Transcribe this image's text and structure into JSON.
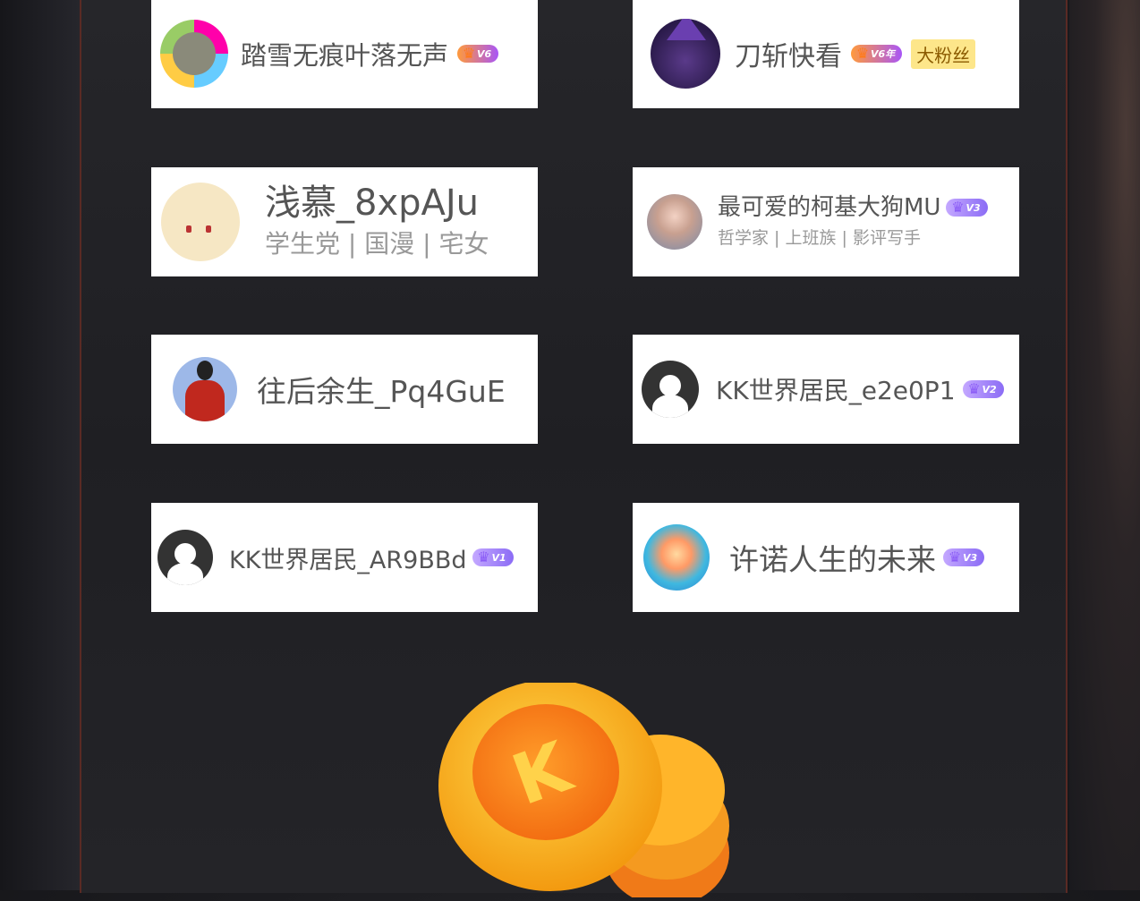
{
  "cards": [
    {
      "name": "踏雪无痕叶落无声",
      "badge": "V6"
    },
    {
      "name": "刀斩快看",
      "badge": "V6年",
      "tag": "大粉丝"
    },
    {
      "name": "浅慕_8xpAJu",
      "subtitle": "学生党 | 国漫 | 宅女"
    },
    {
      "name": "最可爱的柯基大狗MU",
      "badge": "V3",
      "subtitle": "哲学家 | 上班族 | 影评写手"
    },
    {
      "name": "往后余生_Pq4GuE"
    },
    {
      "name": "KK世界居民_e2e0P1",
      "badge": "V2"
    },
    {
      "name": "KK世界居民_AR9BBd",
      "badge": "V1"
    },
    {
      "name": "许诺人生的未来",
      "badge": "V3"
    }
  ],
  "coin": {
    "letter": "K"
  },
  "colors": {
    "frame_border": "#5a2a24",
    "coin_orange": "#ff8a00",
    "coin_yellow": "#ffcc33"
  }
}
